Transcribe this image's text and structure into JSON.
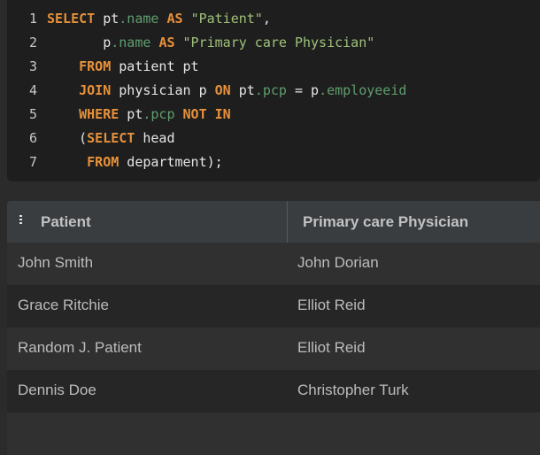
{
  "editor": {
    "lines": [
      {
        "n": "1",
        "tokens": [
          {
            "t": "SELECT",
            "c": "kw"
          },
          {
            "t": " pt",
            "c": "pl"
          },
          {
            "t": ".name",
            "c": "prop"
          },
          {
            "t": " ",
            "c": "pl"
          },
          {
            "t": "AS",
            "c": "kw"
          },
          {
            "t": " ",
            "c": "pl"
          },
          {
            "t": "\"Patient\"",
            "c": "str"
          },
          {
            "t": ",",
            "c": "pl"
          }
        ]
      },
      {
        "n": "2",
        "tokens": [
          {
            "t": "       p",
            "c": "pl"
          },
          {
            "t": ".name",
            "c": "prop"
          },
          {
            "t": " ",
            "c": "pl"
          },
          {
            "t": "AS",
            "c": "kw"
          },
          {
            "t": " ",
            "c": "pl"
          },
          {
            "t": "\"Primary care Physician\"",
            "c": "str"
          }
        ]
      },
      {
        "n": "3",
        "tokens": [
          {
            "t": "    ",
            "c": "pl"
          },
          {
            "t": "FROM",
            "c": "kw"
          },
          {
            "t": " patient pt",
            "c": "pl"
          }
        ]
      },
      {
        "n": "4",
        "tokens": [
          {
            "t": "    ",
            "c": "pl"
          },
          {
            "t": "JOIN",
            "c": "kw"
          },
          {
            "t": " physician p ",
            "c": "pl"
          },
          {
            "t": "ON",
            "c": "kw"
          },
          {
            "t": " pt",
            "c": "pl"
          },
          {
            "t": ".pcp",
            "c": "prop"
          },
          {
            "t": " = p",
            "c": "pl"
          },
          {
            "t": ".employeeid",
            "c": "prop"
          }
        ]
      },
      {
        "n": "5",
        "tokens": [
          {
            "t": "    ",
            "c": "pl"
          },
          {
            "t": "WHERE",
            "c": "kw"
          },
          {
            "t": " pt",
            "c": "pl"
          },
          {
            "t": ".pcp",
            "c": "prop"
          },
          {
            "t": " ",
            "c": "pl"
          },
          {
            "t": "NOT",
            "c": "kw"
          },
          {
            "t": " ",
            "c": "pl"
          },
          {
            "t": "IN",
            "c": "kw"
          }
        ]
      },
      {
        "n": "6",
        "tokens": [
          {
            "t": "    (",
            "c": "pl"
          },
          {
            "t": "SELECT",
            "c": "kw"
          },
          {
            "t": " head",
            "c": "pl"
          }
        ]
      },
      {
        "n": "7",
        "tokens": [
          {
            "t": "     ",
            "c": "pl"
          },
          {
            "t": "FROM",
            "c": "kw"
          },
          {
            "t": " department);",
            "c": "pl"
          }
        ]
      }
    ]
  },
  "results": {
    "drag_icon": "drag-handle-icon",
    "columns": [
      "Patient",
      "Primary care Physician"
    ],
    "rows": [
      [
        "John Smith",
        "John Dorian"
      ],
      [
        "Grace Ritchie",
        "Elliot Reid"
      ],
      [
        "Random J. Patient",
        "Elliot Reid"
      ],
      [
        "Dennis Doe",
        "Christopher Turk"
      ],
      [
        "",
        ""
      ]
    ]
  },
  "colors": {
    "keyword": "#e8913a",
    "string": "#9fc27a",
    "property": "#5f9e6e",
    "editor_bg": "#1e1e1e",
    "header_bg": "#3a3d40"
  }
}
